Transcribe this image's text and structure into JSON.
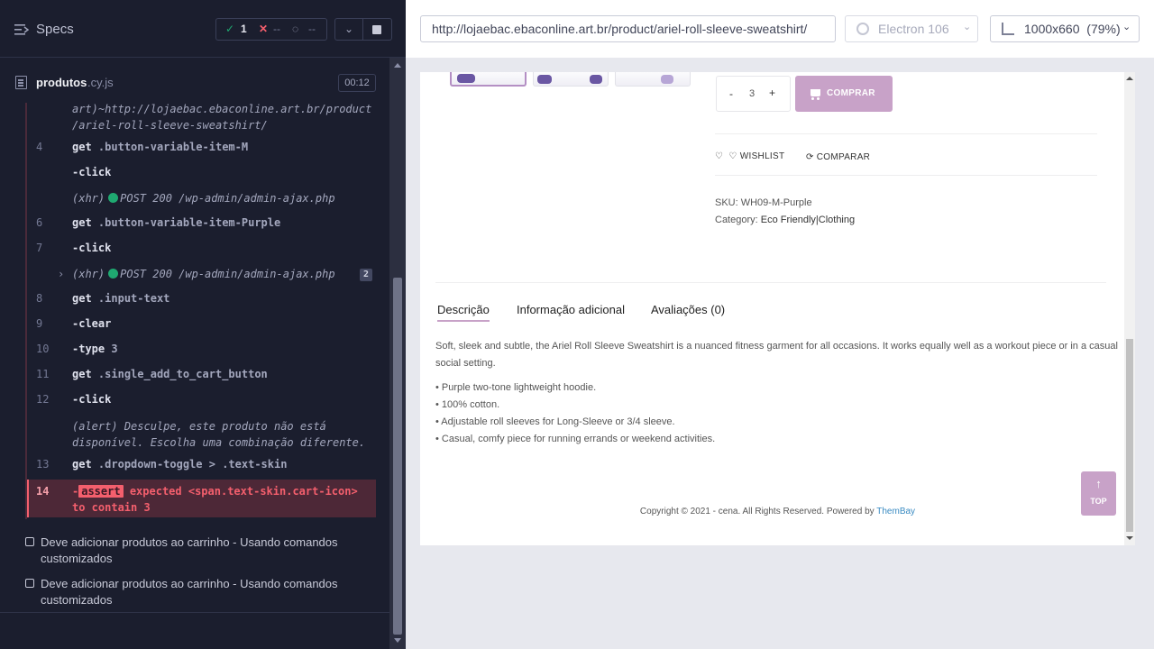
{
  "runner": {
    "specs_label": "Specs",
    "stats": {
      "passed": "1",
      "failed": "--",
      "pending": "--"
    },
    "file": {
      "name": "produtos",
      "ext": ".cy.js",
      "timer": "00:12"
    },
    "visit_url": "art)~http://lojaebac.ebaconline.art.br/product /ariel-roll-sleeve-sweatshirt/",
    "commands": [
      {
        "num": "4",
        "name": "get",
        "arg": ".button-variable-item-M"
      },
      {
        "num": "",
        "name": "-click",
        "arg": ""
      },
      {
        "num": "",
        "name": "(xhr)",
        "arg": "POST 200 /wp-admin/admin-ajax.php"
      },
      {
        "num": "6",
        "name": "get",
        "arg": ".button-variable-item-Purple"
      },
      {
        "num": "7",
        "name": "-click",
        "arg": ""
      },
      {
        "num": "",
        "name": "(xhr)",
        "arg": "POST 200 /wp-admin/admin-ajax.php",
        "badge": "2"
      },
      {
        "num": "8",
        "name": "get",
        "arg": ".input-text"
      },
      {
        "num": "9",
        "name": "-clear",
        "arg": ""
      },
      {
        "num": "10",
        "name": "-type",
        "arg": "3"
      },
      {
        "num": "11",
        "name": "get",
        "arg": ".single_add_to_cart_button"
      },
      {
        "num": "12",
        "name": "-click",
        "arg": ""
      },
      {
        "num": "",
        "name": "(alert)",
        "arg": "Desculpe, este produto não está disponível. Escolha uma combinação diferente."
      },
      {
        "num": "13",
        "name": "get",
        "arg": ".dropdown-toggle > .text-skin"
      }
    ],
    "error": {
      "num": "14",
      "keyword": "assert",
      "text": "expected <span.text-skin.cart-icon> to contain 3"
    },
    "tests": [
      "Deve adicionar produtos ao carrinho - Usando comandos customizados",
      "Deve adicionar produtos ao carrinho - Usando comandos customizados"
    ]
  },
  "aut": {
    "url": "http://lojaebac.ebaconline.art.br/product/ariel-roll-sleeve-sweatshirt/",
    "browser": "Electron 106",
    "viewport": "1000x660  (79%)"
  },
  "page": {
    "qty": {
      "minus": "-",
      "value": "3",
      "plus": "+"
    },
    "buy_label": "COMPRAR",
    "wishlist": "♡  ♡ WISHLIST",
    "compare": "⟳ COMPARAR",
    "sku": "SKU: WH09-M-Purple",
    "category_label": "Category:",
    "category_value": "Eco Friendly|Clothing",
    "tabs": [
      "Descrição",
      "Informação adicional",
      "Avaliações (0)"
    ],
    "description": "Soft, sleek and subtle, the Ariel Roll Sleeve Sweatshirt is a nuanced fitness garment for all occasions. It works equally well as a workout piece or in a casual social setting.",
    "bullets": [
      "• Purple two-tone lightweight hoodie.",
      "• 100% cotton.",
      "• Adjustable roll sleeves for Long-Sleeve or 3/4 sleeve.",
      "• Casual, comfy piece for running errands or weekend activities."
    ],
    "copyright": "Copyright © 2021 - cena. All Rights Reserved. Powered by",
    "copyright_link": "ThemBay",
    "top_arrow": "↑",
    "top_label": "TOP"
  },
  "colors": {
    "runner_bg": "#1b1e2e",
    "pass": "#1fa971",
    "fail": "#f45f6d",
    "accent": "#c8a2c8"
  }
}
